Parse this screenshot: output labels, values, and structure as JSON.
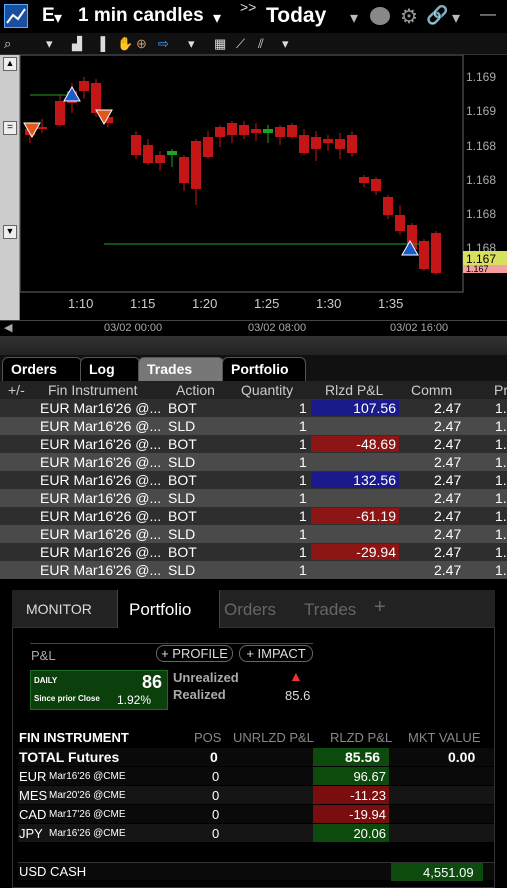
{
  "header": {
    "symbol": "E",
    "timeframe": "1 min candles",
    "period_arrow": ">>",
    "period": "Today"
  },
  "chart_data": {
    "type": "candlestick",
    "y_tick_labels": [
      "1.169",
      "1.169",
      "1.168",
      "1.168",
      "1.168",
      "1.168",
      "1.168"
    ],
    "x_tick_labels": [
      "1:10",
      "1:15",
      "1:20",
      "1:25",
      "1:30",
      "1:35"
    ],
    "last_price_label": "1.167",
    "last_price_label2": "1.167",
    "nav_labels": [
      "03/02 00:00",
      "03/02 08:00",
      "03/02 16:00"
    ]
  },
  "trades": {
    "tabs": [
      "Orders",
      "Log",
      "Trades",
      "Portfolio"
    ],
    "columns": [
      "+/-",
      "Fin Instrument",
      "Action",
      "Quantity",
      "Rlzd P&L",
      "Comm",
      "Pr"
    ],
    "rows": [
      {
        "inst": "EUR Mar16'26 @...",
        "action": "BOT",
        "qty": "1",
        "pnl": "107.56",
        "pnl_color": "#1a1a8c",
        "comm": "2.47",
        "pr": "1."
      },
      {
        "inst": "EUR Mar16'26 @...",
        "action": "SLD",
        "qty": "1",
        "pnl": "",
        "pnl_color": "",
        "comm": "2.47",
        "pr": "1."
      },
      {
        "inst": "EUR Mar16'26 @...",
        "action": "BOT",
        "qty": "1",
        "pnl": "-48.69",
        "pnl_color": "#8b1515",
        "comm": "2.47",
        "pr": "1."
      },
      {
        "inst": "EUR Mar16'26 @...",
        "action": "SLD",
        "qty": "1",
        "pnl": "",
        "pnl_color": "",
        "comm": "2.47",
        "pr": "1."
      },
      {
        "inst": "EUR Mar16'26 @...",
        "action": "BOT",
        "qty": "1",
        "pnl": "132.56",
        "pnl_color": "#1a1a8c",
        "comm": "2.47",
        "pr": "1."
      },
      {
        "inst": "EUR Mar16'26 @...",
        "action": "SLD",
        "qty": "1",
        "pnl": "",
        "pnl_color": "",
        "comm": "2.47",
        "pr": "1."
      },
      {
        "inst": "EUR Mar16'26 @...",
        "action": "BOT",
        "qty": "1",
        "pnl": "-61.19",
        "pnl_color": "#8b1515",
        "comm": "2.47",
        "pr": "1."
      },
      {
        "inst": "EUR Mar16'26 @...",
        "action": "SLD",
        "qty": "1",
        "pnl": "",
        "pnl_color": "",
        "comm": "2.47",
        "pr": "1."
      },
      {
        "inst": "EUR Mar16'26 @...",
        "action": "BOT",
        "qty": "1",
        "pnl": "-29.94",
        "pnl_color": "#8b1515",
        "comm": "2.47",
        "pr": "1."
      },
      {
        "inst": "EUR Mar16'26 @...",
        "action": "SLD",
        "qty": "1",
        "pnl": "",
        "pnl_color": "",
        "comm": "2.47",
        "pr": "1."
      }
    ]
  },
  "monitor": {
    "tabs": [
      "MONITOR",
      "Portfolio",
      "Orders",
      "Trades",
      "+"
    ],
    "pnl_label": "P&L",
    "profile_btn": "+ PROFILE",
    "impact_btn": "+ IMPACT",
    "daily_label": "DAILY",
    "daily_value": "86",
    "since_label": "Since prior Close",
    "since_value": "1.92%",
    "unrealized_label": "Unrealized",
    "realized_label": "Realized",
    "realized_value": "85.6",
    "columns": [
      "FIN INSTRUMENT",
      "POS",
      "UNRLZD P&L",
      "RLZD P&L",
      "MKT VALUE"
    ],
    "total": {
      "name": "TOTAL Futures",
      "pos": "0",
      "rlzd": "85.56",
      "mkt": "0.00"
    },
    "rows": [
      {
        "sym": "EUR",
        "exp": "Mar16'26 @CME",
        "pos": "0",
        "rlzd": "96.67",
        "color": "#0d4a0d"
      },
      {
        "sym": "MES",
        "exp": "Mar20'26 @CME",
        "pos": "0",
        "rlzd": "-11.23",
        "color": "#7a0d0d"
      },
      {
        "sym": "CAD",
        "exp": "Mar17'26 @CME",
        "pos": "0",
        "rlzd": "-19.94",
        "color": "#7a0d0d"
      },
      {
        "sym": "JPY",
        "exp": "Mar16'26 @CME",
        "pos": "0",
        "rlzd": "20.06",
        "color": "#0d4a0d"
      }
    ],
    "cash_label": "USD CASH",
    "cash_value": "4,551.09"
  }
}
